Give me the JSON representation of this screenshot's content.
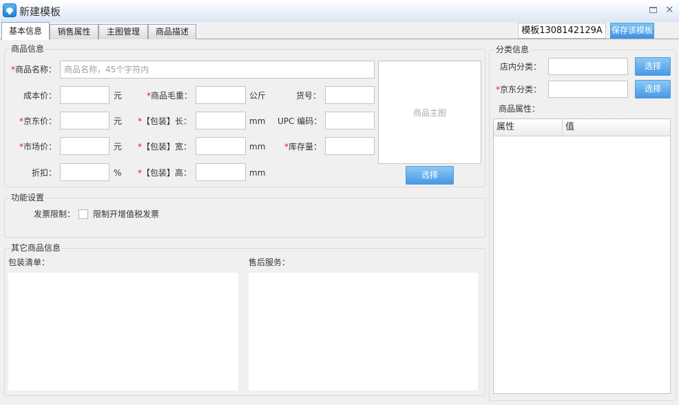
{
  "window": {
    "title": "新建模板",
    "app_icon": "cloud-app-icon",
    "maximize_icon": "maximize-icon",
    "close_icon": "close-icon",
    "close_glyph": "✕"
  },
  "tabs": [
    {
      "label": "基本信息",
      "active": true
    },
    {
      "label": "销售属性",
      "active": false
    },
    {
      "label": "主图管理",
      "active": false
    },
    {
      "label": "商品描述",
      "active": false
    }
  ],
  "template": {
    "name": "模板1308142129A",
    "save_label": "保存该模板"
  },
  "colors": {
    "accent": "#4799e4",
    "required": "#d81e06",
    "tab_border": "#8fa6c1"
  },
  "product_info": {
    "legend": "商品信息",
    "required_mark": "*",
    "name_label": "商品名称：",
    "name_placeholder": "商品名称，45个字符内",
    "cost_label": "成本价：",
    "cost_unit": "元",
    "weight_label": "商品毛重：",
    "weight_unit": "公斤",
    "item_no_label": "货号：",
    "jd_price_label": "京东价：",
    "jd_price_unit": "元",
    "length_label": "【包装】长：",
    "length_unit": "mm",
    "upc_label": "UPC 编码：",
    "market_price_label": "市场价：",
    "market_price_unit": "元",
    "width_label": "【包装】宽：",
    "width_unit": "mm",
    "stock_label": "库存量：",
    "discount_label": "折扣：",
    "discount_unit": "%",
    "height_label": "【包装】高：",
    "height_unit": "mm",
    "main_image_placeholder": "商品主图",
    "select_label": "选择"
  },
  "function_settings": {
    "legend": "功能设置",
    "invoice_label": "发票限制：",
    "invoice_checkbox_label": "限制开增值税发票",
    "invoice_checked": false
  },
  "other_info": {
    "legend": "其它商品信息",
    "packing_list_label": "包装清单：",
    "after_sales_label": "售后服务："
  },
  "category": {
    "legend": "分类信息",
    "shop_category_label": "店内分类：",
    "jd_category_label": "京东分类：",
    "select_label": "选择",
    "attributes_label": "商品属性：",
    "attr_columns": [
      "属性",
      "值"
    ]
  }
}
